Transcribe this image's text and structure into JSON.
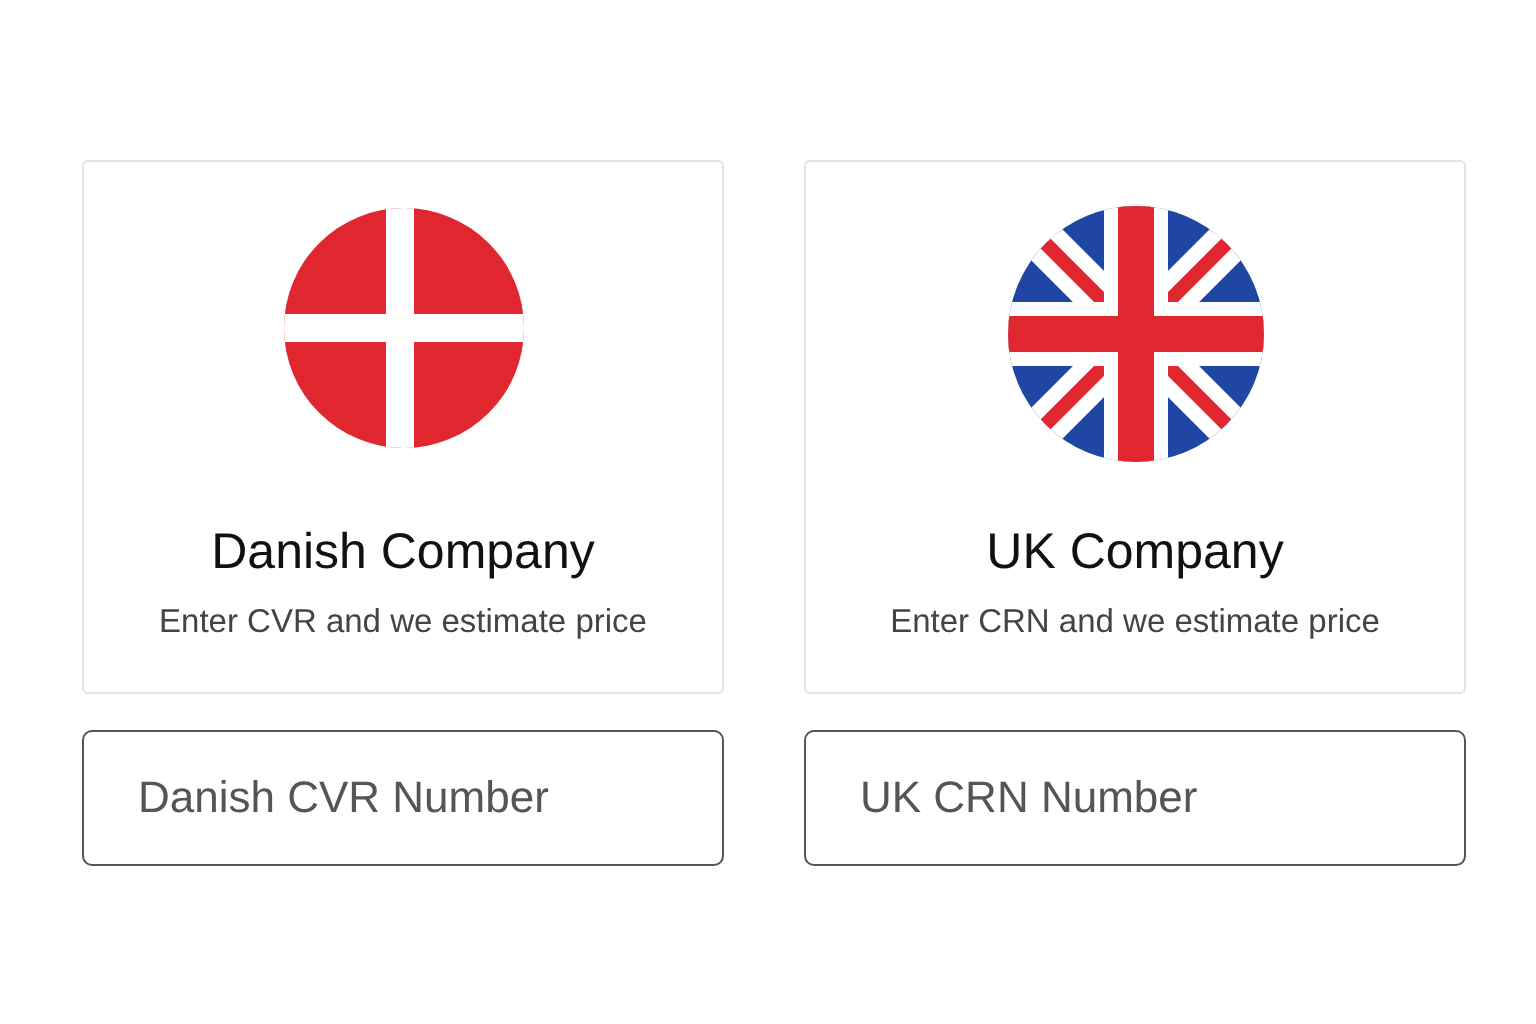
{
  "options": [
    {
      "kind": "denmark",
      "title": "Danish Company",
      "subtitle": "Enter CVR and we estimate price",
      "input": {
        "placeholder": "Danish CVR Number"
      }
    },
    {
      "kind": "uk",
      "title": "UK Company",
      "subtitle": "Enter CRN and we estimate price",
      "input": {
        "placeholder": "UK CRN Number"
      }
    }
  ]
}
